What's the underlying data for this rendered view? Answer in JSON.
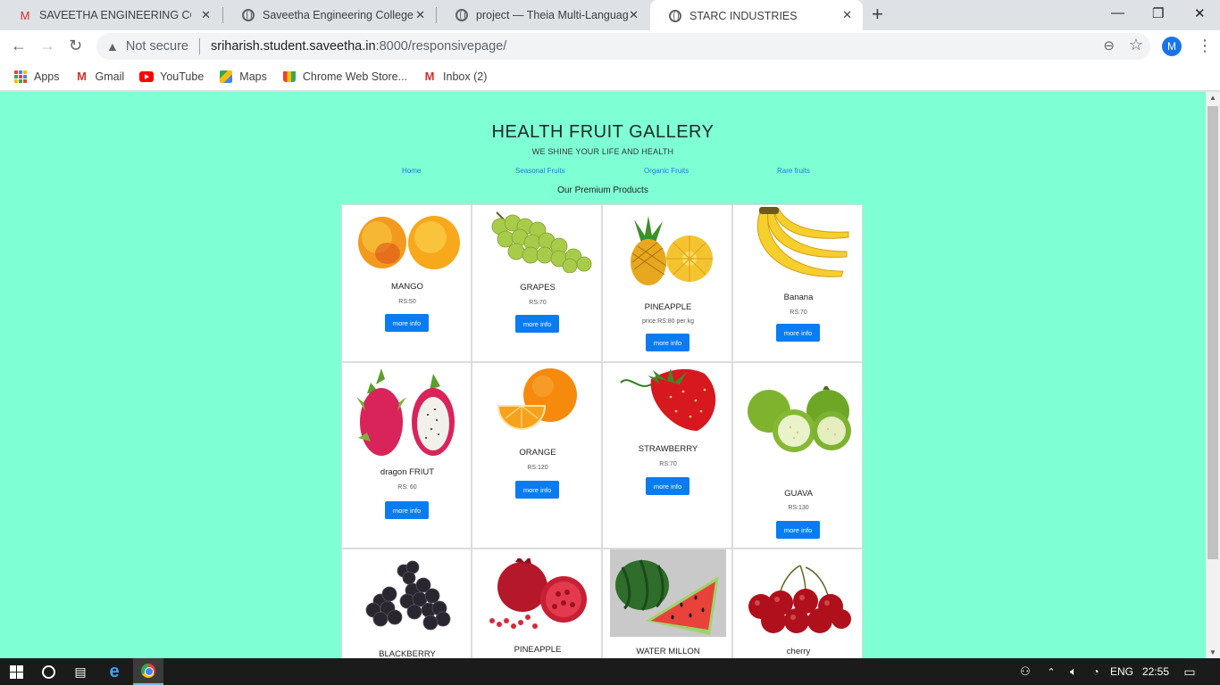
{
  "browser": {
    "tabs": [
      {
        "title": "SAVEETHA ENGINEERING COLLEGE",
        "icon": "gmail-icon",
        "active": false
      },
      {
        "title": "Saveetha Engineering College",
        "icon": "globe-icon",
        "active": false
      },
      {
        "title": "project — Theia Multi-Language",
        "icon": "globe-icon",
        "active": false
      },
      {
        "title": "STARC INDUSTRIES",
        "icon": "globe-icon",
        "active": true
      }
    ],
    "address": {
      "security_label": "Not secure",
      "host": "sriharish.student.saveetha.in",
      "path": ":8000/responsivepage/"
    },
    "profile_initial": "M",
    "bookmarks": [
      {
        "label": "Apps",
        "icon": "apps-grid-icon"
      },
      {
        "label": "Gmail",
        "icon": "gmail-icon"
      },
      {
        "label": "YouTube",
        "icon": "youtube-icon"
      },
      {
        "label": "Maps",
        "icon": "maps-icon"
      },
      {
        "label": "Chrome Web Store...",
        "icon": "chrome-web-store-icon"
      },
      {
        "label": "Inbox (2)",
        "icon": "gmail-icon"
      }
    ]
  },
  "page": {
    "title": "HEALTH FRUIT GALLERY",
    "subtitle": "WE SHINE YOUR LIFE AND HEALTH",
    "nav": [
      "Home",
      "Seasonal Fruits",
      "Organic Fruits",
      "Rare fruits"
    ],
    "section_heading": "Our Premium Products",
    "button_label": "more info",
    "products": [
      {
        "name": "MANGO",
        "price": "RS:50"
      },
      {
        "name": "GRAPES",
        "price": "RS:70"
      },
      {
        "name": "PINEAPPLE",
        "price": "price:RS:80 per kg"
      },
      {
        "name": "Banana",
        "price": "RS:70"
      },
      {
        "name": "dragon FRIUT",
        "price": "RS: 60"
      },
      {
        "name": "ORANGE",
        "price": "RS:120"
      },
      {
        "name": "STRAWBERRY",
        "price": "RS:70"
      },
      {
        "name": "GUAVA",
        "price": "RS:130"
      },
      {
        "name": "BLACKBERRY",
        "price": ""
      },
      {
        "name": "PINEAPPLE",
        "price": ""
      },
      {
        "name": "WATER MILLON",
        "price": ""
      },
      {
        "name": "cherry",
        "price": ""
      }
    ]
  },
  "taskbar": {
    "language": "ENG",
    "time": "22:55"
  }
}
